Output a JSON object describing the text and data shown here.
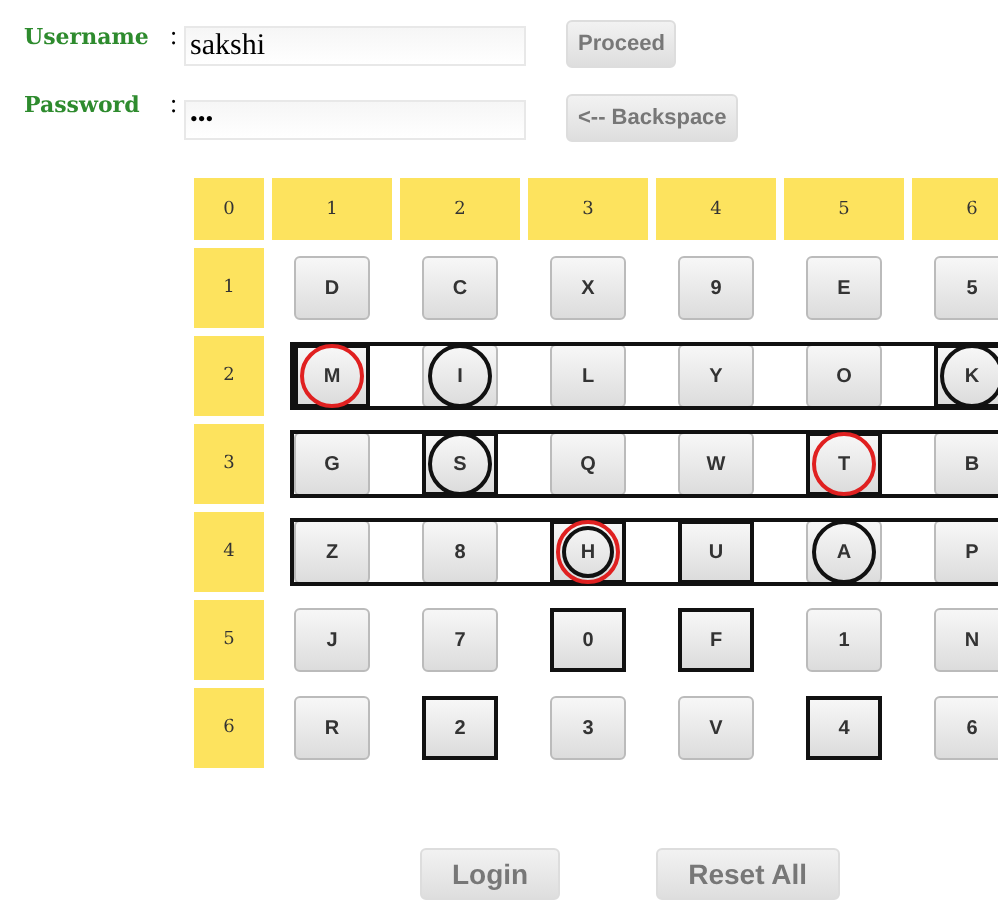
{
  "form": {
    "fields": [
      {
        "label": "Username",
        "separator": ":",
        "kind": "text",
        "value": "sakshi",
        "button": "Proceed"
      },
      {
        "label": "Password",
        "separator": ":",
        "kind": "password",
        "value": "•••",
        "button": "<-- Backspace"
      }
    ]
  },
  "grid": {
    "header": [
      "0",
      "1",
      "2",
      "3",
      "4",
      "5",
      "6"
    ],
    "rows": [
      {
        "label": "1",
        "outlined": false,
        "keys": [
          {
            "label": "D",
            "boxed": false,
            "red_circle": false,
            "black_circle": false
          },
          {
            "label": "C",
            "boxed": false,
            "red_circle": false,
            "black_circle": false
          },
          {
            "label": "X",
            "boxed": false,
            "red_circle": false,
            "black_circle": false
          },
          {
            "label": "9",
            "boxed": false,
            "red_circle": false,
            "black_circle": false
          },
          {
            "label": "E",
            "boxed": false,
            "red_circle": false,
            "black_circle": false
          },
          {
            "label": "5",
            "boxed": false,
            "red_circle": false,
            "black_circle": false
          }
        ]
      },
      {
        "label": "2",
        "outlined": true,
        "keys": [
          {
            "label": "M",
            "boxed": true,
            "red_circle": true,
            "black_circle": false
          },
          {
            "label": "I",
            "boxed": false,
            "red_circle": false,
            "black_circle": true
          },
          {
            "label": "L",
            "boxed": false,
            "red_circle": false,
            "black_circle": false
          },
          {
            "label": "Y",
            "boxed": false,
            "red_circle": false,
            "black_circle": false
          },
          {
            "label": "O",
            "boxed": false,
            "red_circle": false,
            "black_circle": false
          },
          {
            "label": "K",
            "boxed": true,
            "red_circle": false,
            "black_circle": true
          }
        ]
      },
      {
        "label": "3",
        "outlined": true,
        "keys": [
          {
            "label": "G",
            "boxed": false,
            "red_circle": false,
            "black_circle": false
          },
          {
            "label": "S",
            "boxed": true,
            "red_circle": false,
            "black_circle": true
          },
          {
            "label": "Q",
            "boxed": false,
            "red_circle": false,
            "black_circle": false
          },
          {
            "label": "W",
            "boxed": false,
            "red_circle": false,
            "black_circle": false
          },
          {
            "label": "T",
            "boxed": true,
            "red_circle": true,
            "black_circle": false
          },
          {
            "label": "B",
            "boxed": false,
            "red_circle": false,
            "black_circle": false
          }
        ]
      },
      {
        "label": "4",
        "outlined": true,
        "keys": [
          {
            "label": "Z",
            "boxed": false,
            "red_circle": false,
            "black_circle": false
          },
          {
            "label": "8",
            "boxed": false,
            "red_circle": false,
            "black_circle": false
          },
          {
            "label": "H",
            "boxed": true,
            "red_circle": true,
            "black_circle": true
          },
          {
            "label": "U",
            "boxed": true,
            "red_circle": false,
            "black_circle": false
          },
          {
            "label": "A",
            "boxed": false,
            "red_circle": false,
            "black_circle": true
          },
          {
            "label": "P",
            "boxed": false,
            "red_circle": false,
            "black_circle": false
          }
        ]
      },
      {
        "label": "5",
        "outlined": false,
        "keys": [
          {
            "label": "J",
            "boxed": false,
            "red_circle": false,
            "black_circle": false
          },
          {
            "label": "7",
            "boxed": false,
            "red_circle": false,
            "black_circle": false
          },
          {
            "label": "0",
            "boxed": true,
            "red_circle": false,
            "black_circle": false
          },
          {
            "label": "F",
            "boxed": true,
            "red_circle": false,
            "black_circle": false
          },
          {
            "label": "1",
            "boxed": false,
            "red_circle": false,
            "black_circle": false
          },
          {
            "label": "N",
            "boxed": false,
            "red_circle": false,
            "black_circle": false
          }
        ]
      },
      {
        "label": "6",
        "outlined": false,
        "keys": [
          {
            "label": "R",
            "boxed": false,
            "red_circle": false,
            "black_circle": false
          },
          {
            "label": "2",
            "boxed": true,
            "red_circle": false,
            "black_circle": false
          },
          {
            "label": "3",
            "boxed": false,
            "red_circle": false,
            "black_circle": false
          },
          {
            "label": "V",
            "boxed": false,
            "red_circle": false,
            "black_circle": false
          },
          {
            "label": "4",
            "boxed": true,
            "red_circle": false,
            "black_circle": false
          },
          {
            "label": "6",
            "boxed": false,
            "red_circle": false,
            "black_circle": false
          }
        ]
      }
    ]
  },
  "actions": [
    "Login",
    "Reset All"
  ]
}
